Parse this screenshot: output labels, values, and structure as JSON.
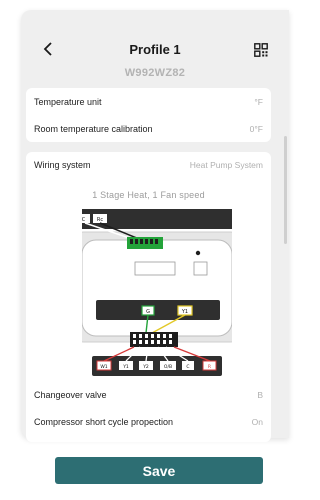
{
  "header": {
    "title": "Profile 1",
    "subtitle": "W992WZ82",
    "back_icon": "chevron-left-icon",
    "qr_icon": "qr-code-icon"
  },
  "settings_basic": [
    {
      "label": "Temperature unit",
      "value": "°F"
    },
    {
      "label": "Room temperature calibration",
      "value": "0°F"
    }
  ],
  "wiring": {
    "label": "Wiring system",
    "value": "Heat Pump System",
    "stage_label": "1 Stage Heat, 1 Fan speed",
    "top_connector": [
      "C",
      "Rc"
    ],
    "middle_connector": [
      "G",
      "Y1"
    ],
    "bottom_connector": [
      "W1",
      "Y1",
      "Y2",
      "O/B",
      "C",
      "R"
    ],
    "wire_colors": {
      "green": "#23a33a",
      "yellow": "#e3c928",
      "red": "#d63a3a",
      "black": "#1e1e1e",
      "white": "#ffffff"
    }
  },
  "settings_more": [
    {
      "label": "Changeover valve",
      "value": "B"
    },
    {
      "label": "Compressor short cycle propection",
      "value": "On"
    }
  ],
  "actions": {
    "save_label": "Save"
  },
  "colors": {
    "primary": "#2d6e73",
    "panel": "#efefef"
  }
}
